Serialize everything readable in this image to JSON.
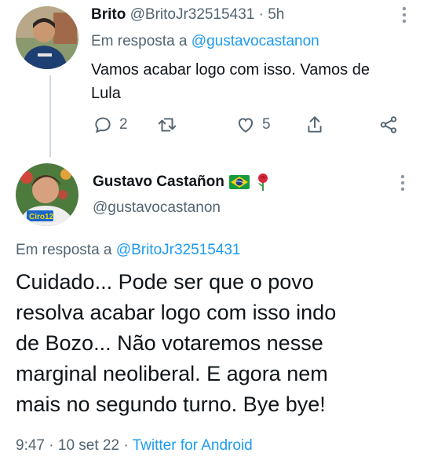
{
  "reply_tweet": {
    "author_name": "Brito",
    "author_handle": "@BritoJr32515431",
    "separator": "·",
    "time_ago": "5h",
    "reply_prefix": "Em resposta a",
    "reply_to": "@gustavocastanon",
    "text_line1": "Vamos acabar logo com isso. Vamos de",
    "text_line2": "Lula",
    "actions": {
      "reply_count": "2",
      "retweet_count": "",
      "like_count": "5"
    }
  },
  "main_tweet": {
    "author_name": "Gustavo Castañon",
    "author_handle": "@gustavocastanon",
    "avatar_badge": "Ciro12",
    "reply_prefix": "Em resposta a",
    "reply_to": "@BritoJr32515431",
    "text_lines": [
      "Cuidado... Pode ser que o povo",
      "resolva acabar logo com isso indo",
      "de Bozo... Não votaremos nesse",
      "marginal neoliberal. E agora nem",
      "mais no segundo turno. Bye bye!"
    ],
    "time": "9:47",
    "date": "10 set 22",
    "source": "Twitter for Android"
  },
  "icons": {
    "more": "more-options-icon",
    "reply": "reply-icon",
    "retweet": "retweet-icon",
    "like": "like-icon",
    "share": "share-icon",
    "network": "network-share-icon",
    "flag": "brazil-flag-icon",
    "rose": "rose-icon"
  },
  "colors": {
    "link": "#1d9bf0",
    "muted": "#536471",
    "text": "#0f1419",
    "thread_line": "#cfd9de"
  }
}
